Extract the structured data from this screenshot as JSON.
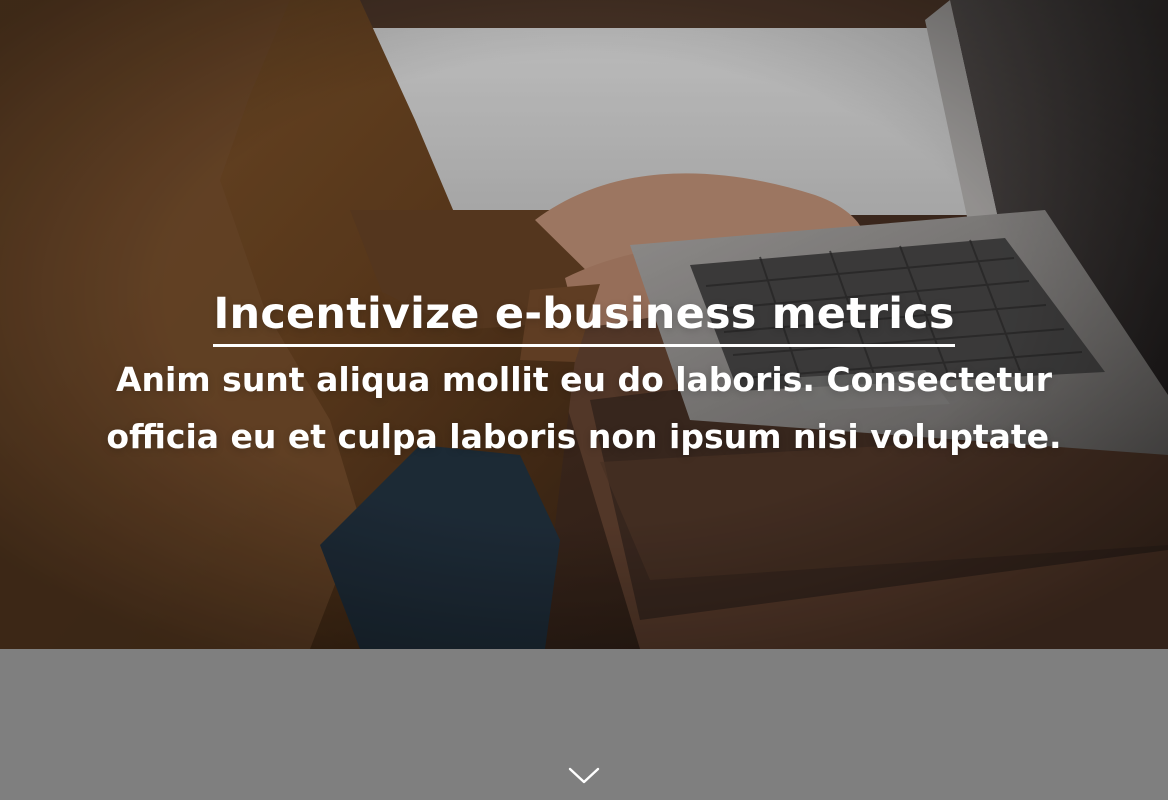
{
  "hero": {
    "title": "Incentivize e-business metrics",
    "subtitle": "Anim sunt aliqua mollit eu do laboris. Consectetur officia eu et culpa laboris non ipsum nisi voluptate.",
    "image_icon": "laptop-photo"
  },
  "footer": {
    "scroll_icon": "chevron-down-icon"
  },
  "colors": {
    "overlay": "#000000",
    "bottom_band": "#7f7f7f",
    "text": "#ffffff"
  }
}
